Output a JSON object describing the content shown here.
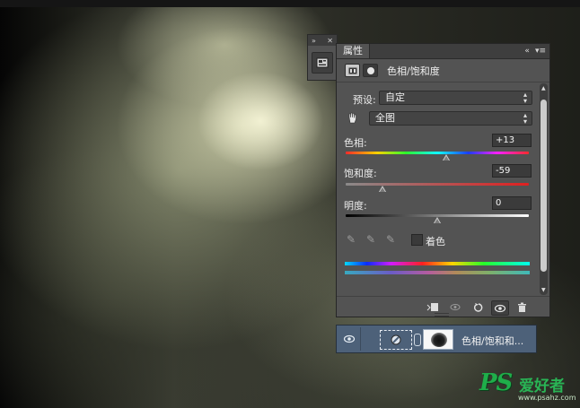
{
  "dock": {
    "collapse_icon": "double-chevron-right-icon",
    "close_icon": "close-icon",
    "properties_button_icon": "properties-panel-icon"
  },
  "panel": {
    "tab_label": "属性",
    "collapse_icon": "double-chevron-left-icon",
    "menu_icon": "panel-menu-icon",
    "title": "色相/饱和度",
    "preset_label": "预设:",
    "preset_value": "自定",
    "channel_tool_icon": "targeted-adjustment-hand-icon",
    "channel_value": "全图",
    "hue_label": "色相:",
    "hue_value": "+13",
    "saturation_label": "饱和度:",
    "saturation_value": "-59",
    "lightness_label": "明度:",
    "lightness_value": "0",
    "colorize_label": "着色",
    "colorize_checked": false,
    "slider_levels": {
      "hue": 0.55,
      "saturation": 0.2,
      "lightness": 0.5
    },
    "footer_icons": [
      "clip-to-layer-icon",
      "view-previous-state-icon",
      "reset-icon",
      "visibility-eye-icon",
      "trash-icon"
    ]
  },
  "layer": {
    "name": "色相/饱和和...",
    "visible_icon": "eye-icon"
  },
  "watermark": {
    "logo": "PS",
    "site_cn": "爱好者",
    "url": "www.psahz.com"
  }
}
